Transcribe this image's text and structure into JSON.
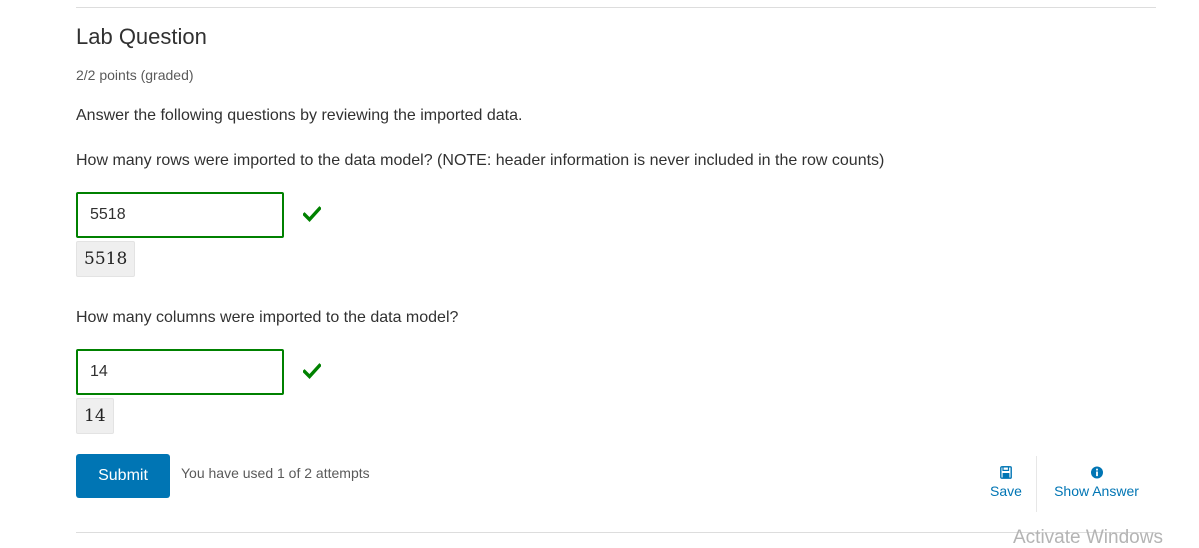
{
  "problem": {
    "title": "Lab Question",
    "points": "2/2 points (graded)",
    "intro": "Answer the following questions by reviewing the imported data."
  },
  "questions": [
    {
      "prompt": "How many rows were imported to the data model? (NOTE: header information is never included in the row counts)",
      "value": "5518",
      "preview": "5518",
      "status": "correct"
    },
    {
      "prompt": "How many columns were imported to the data model?",
      "value": "14",
      "preview": "14",
      "status": "correct"
    }
  ],
  "actions": {
    "submit_label": "Submit",
    "attempts_text": "You have used 1 of 2 attempts",
    "save_label": "Save",
    "show_answer_label": "Show Answer"
  },
  "colors": {
    "correct": "#008100",
    "accent": "#0075b4"
  },
  "icons": {
    "correct": "check-icon",
    "save": "floppy-disk-icon",
    "show_answer": "info-circle-icon"
  },
  "watermark": "Activate Windows"
}
